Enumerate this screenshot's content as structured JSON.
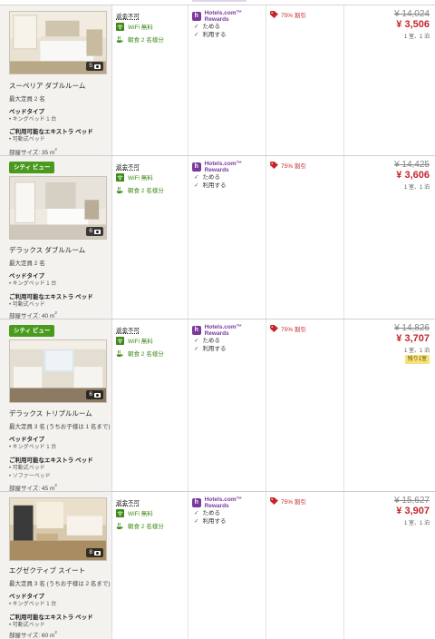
{
  "rows": [
    {
      "badge": "",
      "photo_count": "5",
      "name": "スーペリア ダブルルーム",
      "capacity": "最大定員 2 名",
      "bed_type_label": "ベッドタイプ",
      "bed_type": "キングベッド 1 台",
      "extra_bed_label": "ご利用可能なエキストラ ベッド",
      "extra_beds": [
        "可動式ベッド"
      ],
      "size_label": "部屋サイズ: 35 m",
      "refund": "返金不可",
      "wifi": "WiFi 無料",
      "breakfast": "朝食 2 名様分",
      "rewards_title": "Hotels.com™ Rewards",
      "rewards_items": [
        "ためる",
        "利用する"
      ],
      "deal": "75% 割引",
      "price_old": "¥ 14,024",
      "price_new": "¥ 3,506",
      "price_note": "1 室、1 泊",
      "left": ""
    },
    {
      "badge": "シティ ビュー",
      "photo_count": "6",
      "name": "デラックス ダブルルーム",
      "capacity": "最大定員 2 名",
      "bed_type_label": "ベッドタイプ",
      "bed_type": "キングベッド 1 台",
      "extra_bed_label": "ご利用可能なエキストラ ベッド",
      "extra_beds": [
        "可動式ベッド"
      ],
      "size_label": "部屋サイズ: 40 m",
      "refund": "返金不可",
      "wifi": "WiFi 無料",
      "breakfast": "朝食 2 名様分",
      "rewards_title": "Hotels.com™ Rewards",
      "rewards_items": [
        "ためる",
        "利用する"
      ],
      "deal": "75% 割引",
      "price_old": "¥ 14,425",
      "price_new": "¥ 3,606",
      "price_note": "1 室、1 泊",
      "left": ""
    },
    {
      "badge": "シティ ビュー",
      "photo_count": "6",
      "name": "デラックス トリプルルーム",
      "capacity": "最大定員 3 名 (うちお子様は 1 名まで)",
      "bed_type_label": "ベッドタイプ",
      "bed_type": "キングベッド 1 台",
      "extra_bed_label": "ご利用可能なエキストラ ベッド",
      "extra_beds": [
        "可動式ベッド",
        "ソファーベッド"
      ],
      "size_label": "部屋サイズ: 45 m",
      "refund": "返金不可",
      "wifi": "WiFi 無料",
      "breakfast": "朝食 2 名様分",
      "rewards_title": "Hotels.com™ Rewards",
      "rewards_items": [
        "ためる",
        "利用する"
      ],
      "deal": "75% 割引",
      "price_old": "¥ 14,826",
      "price_new": "¥ 3,707",
      "price_note": "1 室、1 泊",
      "left": "残り1室"
    },
    {
      "badge": "",
      "photo_count": "8",
      "name": "エグゼクティブ スイート",
      "capacity": "最大定員 3 名 (うちお子様は 2 名まで)",
      "bed_type_label": "ベッドタイプ",
      "bed_type": "キングベッド 1 台",
      "extra_bed_label": "ご利用可能なエキストラ ベッド",
      "extra_beds": [
        "可動式ベッド"
      ],
      "size_label": "部屋サイズ: 60 m",
      "refund": "返金不可",
      "wifi": "WiFi 無料",
      "breakfast": "朝食 2 名様分",
      "rewards_title": "Hotels.com™ Rewards",
      "rewards_items": [
        "ためる",
        "利用する"
      ],
      "deal": "75% 割引",
      "price_old": "¥ 15,627",
      "price_new": "¥ 3,907",
      "price_note": "1 室、1 泊",
      "left": ""
    }
  ],
  "size_unit_sup": "2",
  "colors": {
    "discount_red": "#c2272d",
    "amenity_green": "#3e8a1a",
    "rewards_purple": "#7a3a9c",
    "view_badge_green": "#4a9a1e",
    "left_badge_yellow": "#f6e27a"
  },
  "icons": {
    "photo": "camera-icon",
    "wifi": "wifi-icon",
    "breakfast": "breakfast-icon",
    "rewards": "rewards-logo-icon",
    "deal": "price-tag-icon",
    "check": "check-icon"
  }
}
